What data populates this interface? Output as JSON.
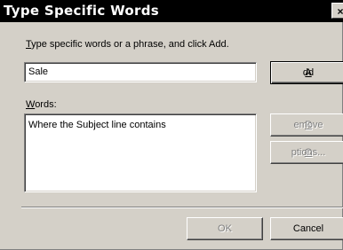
{
  "window": {
    "title": "Type Specific Words",
    "close_glyph": "×"
  },
  "instruction": {
    "mnemonic": "T",
    "rest": "ype specific words or a phrase, and click Add."
  },
  "phrase_input": {
    "value": "Sale"
  },
  "add_button": {
    "mnemonic": "A",
    "rest": "dd"
  },
  "words_label": {
    "mnemonic": "W",
    "rest": "ords:"
  },
  "words_list": {
    "items": [
      "Where the Subject line contains"
    ]
  },
  "remove_button": {
    "mnemonic": "R",
    "rest": "emove",
    "enabled": false
  },
  "options_button": {
    "mnemonic": "O",
    "rest": "ptions...",
    "enabled": false
  },
  "ok_button": {
    "label": "OK",
    "enabled": false
  },
  "cancel_button": {
    "label": "Cancel"
  }
}
